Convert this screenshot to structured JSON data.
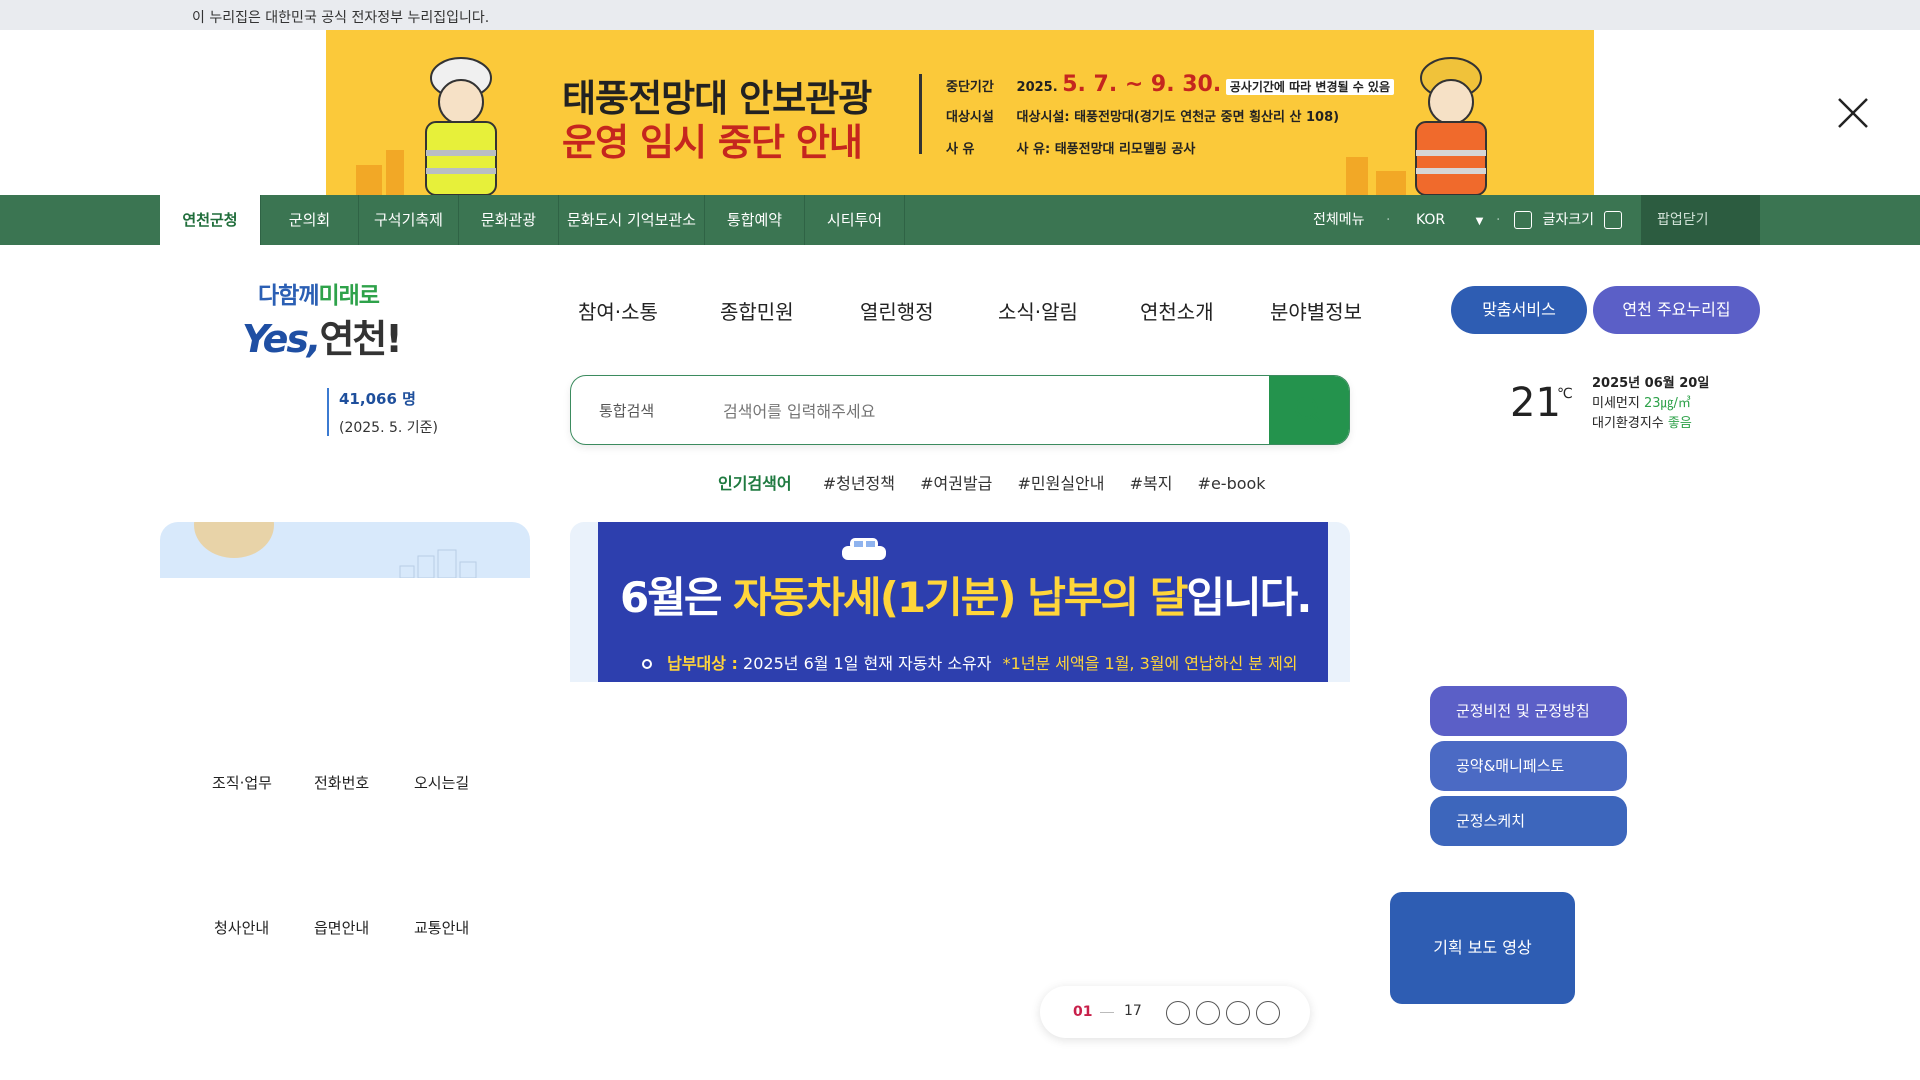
{
  "gov_notice": "이 누리집은 대한민국 공식 전자정부 누리집입니다.",
  "popup": {
    "title_line1": "태풍전망대 안보관광",
    "title_line2": "운영 임시 중단 안내",
    "period_label": "중단기간",
    "period_year": "2025.",
    "period_range": "5. 7. ~ 9. 30.",
    "period_note": "공사기간에 따라 변경될 수 있음",
    "facility_label": "대상시설",
    "facility_value": "대상시설: 태풍전망대(경기도 연천군 중면 횡산리 산 108)",
    "reason_label": "사  유",
    "reason_value": "사 유: 태풍전망대 리모델링 공사",
    "close_icon": "close-icon"
  },
  "topnav": {
    "items": [
      "연천군청",
      "군의회",
      "구석기축제",
      "문화관광",
      "문화도시 기억보관소",
      "통합예약",
      "시티투어"
    ],
    "all_menu": "전체메뉴",
    "lang": "KOR",
    "font_size": "글자크기",
    "popup_close": "팝업닫기"
  },
  "logo": {
    "slogan_a": "다함께",
    "slogan_b": "미래로",
    "yes": "Yes,",
    "name": "연천!"
  },
  "main_menu": [
    "참여·소통",
    "종합민원",
    "열린행정",
    "소식·알림",
    "연천소개",
    "분야별정보"
  ],
  "pills": {
    "custom": "맞춤서비스",
    "major_sites": "연천 주요누리집"
  },
  "population": {
    "count": "41,066 명",
    "date": "(2025. 5. 기준)"
  },
  "search": {
    "category": "통합검색",
    "placeholder": "검색어를 입력해주세요"
  },
  "popular": {
    "label": "인기검색어",
    "tags": [
      "#청년정책",
      "#여권발급",
      "#민원실안내",
      "#복지",
      "#e-book"
    ]
  },
  "weather": {
    "temp": "21",
    "unit": "℃",
    "date": "2025년 06월 20일",
    "dust_label": "미세먼지",
    "dust_value": "23㎍/㎥",
    "air_label": "대기환경지수",
    "air_value": "좋음"
  },
  "banner": {
    "h_a": "6월",
    "h_b": "은 ",
    "h_c": "자동차세(1기분) 납부의 달",
    "h_d": "입니다.",
    "sub_label": "납부대상 :",
    "sub_value": "2025년 6월 1일 현재 자동차 소유자",
    "sub_note": "*1년분 세액을 1월, 3월에 연납하신 분 제외"
  },
  "quick_links": [
    "조직·업무",
    "전화번호",
    "오시는길",
    "청사안내",
    "읍면안내",
    "교통안내"
  ],
  "right_buttons": [
    "군정비전 및 군정방침",
    "공약&매니페스토",
    "군정스케치"
  ],
  "video_button": "기획 보도 영상",
  "pager": {
    "current": "01",
    "total": "17"
  },
  "colors": {
    "nav_green": "#3b7552",
    "brand_blue": "#2e5db3",
    "purple": "#5b5fc7",
    "banner_yellow": "#fbc93a"
  }
}
